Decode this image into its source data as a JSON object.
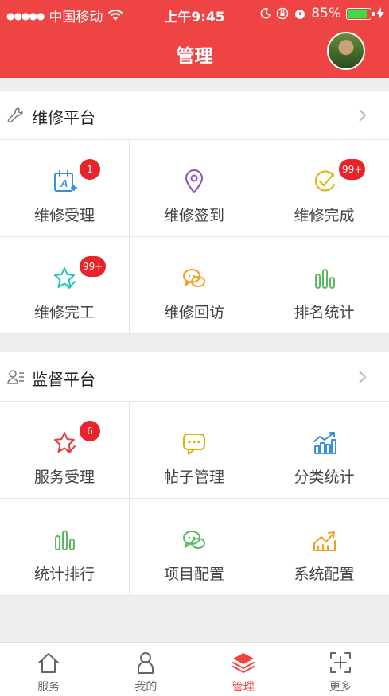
{
  "status_bar": {
    "signal": "●●●●●",
    "carrier": "中国移动",
    "wifi": "wifi-icon",
    "time": "上午9:45",
    "battery_percent": "85%",
    "battery_level": 0.85
  },
  "nav": {
    "title": "管理"
  },
  "sections": [
    {
      "title": "维修平台",
      "icon": "wrench-icon",
      "items": [
        {
          "label": "维修受理",
          "icon": "calendar-icon",
          "color": "#3b8fe0",
          "badge": "1"
        },
        {
          "label": "维修签到",
          "icon": "location-pin-icon",
          "color": "#8a4fc2",
          "badge": ""
        },
        {
          "label": "维修完成",
          "icon": "check-circle-icon",
          "color": "#e0b100",
          "badge": "99+"
        },
        {
          "label": "维修完工",
          "icon": "star-check-icon",
          "color": "#1cc9c0",
          "badge": "99+"
        },
        {
          "label": "维修回访",
          "icon": "chat-bubbles-icon",
          "color": "#f0a020",
          "badge": ""
        },
        {
          "label": "排名统计",
          "icon": "bar-chart-icon",
          "color": "#5cb85c",
          "badge": ""
        }
      ]
    },
    {
      "title": "监督平台",
      "icon": "person-list-icon",
      "items": [
        {
          "label": "服务受理",
          "icon": "star-check-icon",
          "color": "#e04040",
          "badge": "6"
        },
        {
          "label": "帖子管理",
          "icon": "chat-dots-icon",
          "color": "#e0b100",
          "badge": ""
        },
        {
          "label": "分类统计",
          "icon": "bar-trend-chart-icon",
          "color": "#3b8fe0",
          "badge": ""
        },
        {
          "label": "统计排行",
          "icon": "bar-chart-icon",
          "color": "#5cb85c",
          "badge": ""
        },
        {
          "label": "项目配置",
          "icon": "chat-bubbles-icon",
          "color": "#5cb85c",
          "badge": ""
        },
        {
          "label": "系统配置",
          "icon": "trend-arrow-icon",
          "color": "#f0a020",
          "badge": ""
        }
      ]
    }
  ],
  "tabbar": [
    {
      "label": "服务",
      "icon": "home-icon",
      "active": false
    },
    {
      "label": "我的",
      "icon": "user-icon",
      "active": false
    },
    {
      "label": "管理",
      "icon": "layers-icon",
      "active": true
    },
    {
      "label": "更多",
      "icon": "add-frame-icon",
      "active": false
    }
  ],
  "colors": {
    "primary": "#ef4444",
    "badge": "#e8232a",
    "background": "#eeeeee"
  }
}
